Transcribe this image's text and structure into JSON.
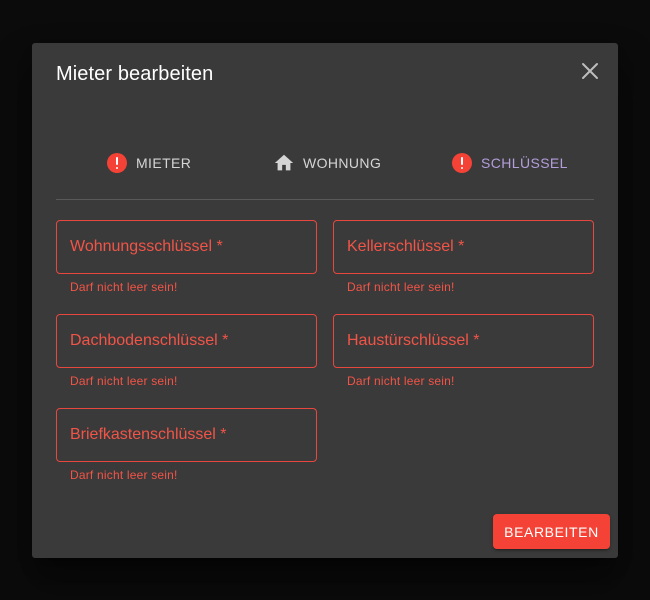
{
  "dialog": {
    "title": "Mieter bearbeiten",
    "close_icon": "close-icon"
  },
  "stepper": {
    "steps": [
      {
        "label": "MIETER",
        "icon": "error-icon",
        "state": "error"
      },
      {
        "label": "WOHNUNG",
        "icon": "home-icon",
        "state": "done"
      },
      {
        "label": "SCHLÜSSEL",
        "icon": "error-icon",
        "state": "active-error"
      }
    ]
  },
  "form": {
    "fields": [
      {
        "label": "Wohnungsschlüssel *",
        "error": "Darf nicht leer sein!"
      },
      {
        "label": "Kellerschlüssel *",
        "error": "Darf nicht leer sein!"
      },
      {
        "label": "Dachbodenschlüssel *",
        "error": "Darf nicht leer sein!"
      },
      {
        "label": "Haustürschlüssel *",
        "error": "Darf nicht leer sein!"
      },
      {
        "label": "Briefkastenschlüssel *",
        "error": "Darf nicht leer sein!"
      }
    ]
  },
  "actions": {
    "submit_label": "BEARBEITEN"
  },
  "colors": {
    "error": "#f44336",
    "active_step": "#b39ddb",
    "surface": "#3a3a3a",
    "backdrop": "#0b0b0b"
  }
}
